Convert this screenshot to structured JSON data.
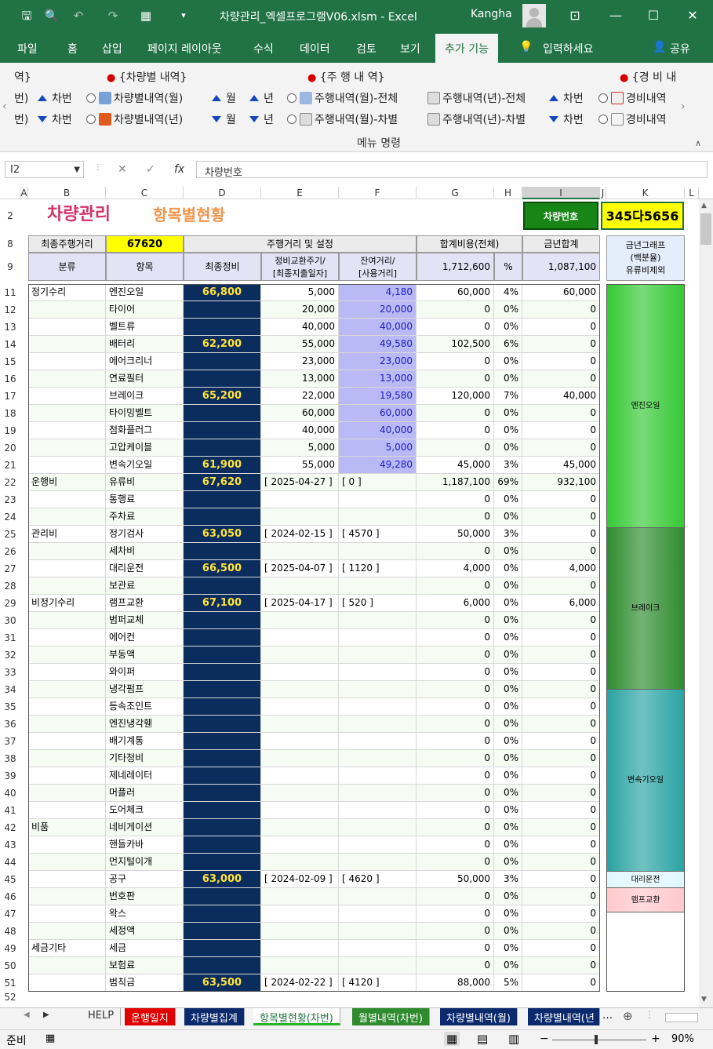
{
  "titlebar": {
    "title": "차량관리_엑셀프로그램V06.xlsm  -  Excel",
    "user": "Kangha"
  },
  "ribbon_tabs": [
    "파일",
    "홈",
    "삽입",
    "페이지 레이아웃",
    "수식",
    "데이터",
    "검토",
    "보기",
    "추가 기능"
  ],
  "tell_me": "입력하세요",
  "share": "공유",
  "ribbon": {
    "group1_head": "역}",
    "group2_head": "{차량별 내역}",
    "group3_head": "{주 행 내 역}",
    "group4_head": "{경 비 내",
    "row1": [
      "번)",
      "차번",
      "차량별내역(월)",
      "월",
      "년",
      "주행내역(월)-전체",
      "주행내역(년)-전체",
      "차번",
      "경비내역"
    ],
    "row2": [
      "번)",
      "차번",
      "차량별내역(년)",
      "월",
      "년",
      "주행내역(월)-차별",
      "주행내역(년)-차별",
      "차번",
      "경비내역"
    ],
    "menu_label": "메뉴 명령"
  },
  "formula_bar": {
    "namebox": "I2",
    "formula": "차량번호"
  },
  "columns": [
    "A",
    "B",
    "C",
    "D",
    "E",
    "F",
    "G",
    "H",
    "I",
    "J",
    "K",
    "L"
  ],
  "sheet": {
    "title": "차량관리",
    "subtitle": "항목별현황",
    "car_label": "차량번호",
    "car_no": "345다5656",
    "last_mileage_label": "최종주행거리",
    "last_mileage": "67620",
    "h_setting": "주행거리 및 설정",
    "h_total": "합계비용(전체)",
    "h_year": "금년합계",
    "h_graph": "금년그래프\n(백분율)\n유류비제외",
    "h_cat": "분류",
    "h_item": "항목",
    "h_last": "최종정비",
    "h_cycle": "정비교환주기/\n[최종지출일자]",
    "h_remain": "잔여거리/\n[사용거리]",
    "total_all": "1,712,600",
    "pct_label": "%",
    "total_year": "1,087,100"
  },
  "rows": [
    {
      "n": "11",
      "cat": "정기수리",
      "item": "엔진오일",
      "last": "66,800",
      "cycle": "5,000",
      "remain": "4,180",
      "total": "60,000",
      "pct": "4%",
      "year": "60,000"
    },
    {
      "n": "12",
      "cat": "",
      "item": "타이어",
      "last": "",
      "cycle": "20,000",
      "remain": "20,000",
      "total": "0",
      "pct": "0%",
      "year": "0"
    },
    {
      "n": "13",
      "cat": "",
      "item": "벨트류",
      "last": "",
      "cycle": "40,000",
      "remain": "40,000",
      "total": "0",
      "pct": "0%",
      "year": "0"
    },
    {
      "n": "14",
      "cat": "",
      "item": "배터리",
      "last": "62,200",
      "cycle": "55,000",
      "remain": "49,580",
      "total": "102,500",
      "pct": "6%",
      "year": "0"
    },
    {
      "n": "15",
      "cat": "",
      "item": "에어크리너",
      "last": "",
      "cycle": "23,000",
      "remain": "23,000",
      "total": "0",
      "pct": "0%",
      "year": "0"
    },
    {
      "n": "16",
      "cat": "",
      "item": "연료필터",
      "last": "",
      "cycle": "13,000",
      "remain": "13,000",
      "total": "0",
      "pct": "0%",
      "year": "0"
    },
    {
      "n": "17",
      "cat": "",
      "item": "브레이크",
      "last": "65,200",
      "cycle": "22,000",
      "remain": "19,580",
      "total": "120,000",
      "pct": "7%",
      "year": "40,000"
    },
    {
      "n": "18",
      "cat": "",
      "item": "타이밍벨트",
      "last": "",
      "cycle": "60,000",
      "remain": "60,000",
      "total": "0",
      "pct": "0%",
      "year": "0"
    },
    {
      "n": "19",
      "cat": "",
      "item": "점화플러그",
      "last": "",
      "cycle": "40,000",
      "remain": "40,000",
      "total": "0",
      "pct": "0%",
      "year": "0"
    },
    {
      "n": "20",
      "cat": "",
      "item": "고압케이블",
      "last": "",
      "cycle": "5,000",
      "remain": "5,000",
      "total": "0",
      "pct": "0%",
      "year": "0"
    },
    {
      "n": "21",
      "cat": "",
      "item": "변속기오일",
      "last": "61,900",
      "cycle": "55,000",
      "remain": "49,280",
      "total": "45,000",
      "pct": "3%",
      "year": "45,000"
    },
    {
      "n": "22",
      "cat": "운행비",
      "item": "유류비",
      "last": "67,620",
      "cycle": "[ 2025-04-27 ]",
      "remain": "[ 0 ]",
      "total": "1,187,100",
      "pct": "69%",
      "year": "932,100"
    },
    {
      "n": "23",
      "cat": "",
      "item": "통행료",
      "last": "",
      "cycle": "",
      "remain": "",
      "total": "0",
      "pct": "0%",
      "year": "0"
    },
    {
      "n": "24",
      "cat": "",
      "item": "주차료",
      "last": "",
      "cycle": "",
      "remain": "",
      "total": "0",
      "pct": "0%",
      "year": "0"
    },
    {
      "n": "25",
      "cat": "관리비",
      "item": "정기검사",
      "last": "63,050",
      "cycle": "[ 2024-02-15 ]",
      "remain": "[ 4570 ]",
      "total": "50,000",
      "pct": "3%",
      "year": "0"
    },
    {
      "n": "26",
      "cat": "",
      "item": "세차비",
      "last": "",
      "cycle": "",
      "remain": "",
      "total": "0",
      "pct": "0%",
      "year": "0"
    },
    {
      "n": "27",
      "cat": "",
      "item": "대리운전",
      "last": "66,500",
      "cycle": "[ 2025-04-07 ]",
      "remain": "[ 1120 ]",
      "total": "4,000",
      "pct": "0%",
      "year": "4,000"
    },
    {
      "n": "28",
      "cat": "",
      "item": "보관료",
      "last": "",
      "cycle": "",
      "remain": "",
      "total": "0",
      "pct": "0%",
      "year": "0"
    },
    {
      "n": "29",
      "cat": "비정기수리",
      "item": "램프교환",
      "last": "67,100",
      "cycle": "[ 2025-04-17 ]",
      "remain": "[ 520 ]",
      "total": "6,000",
      "pct": "0%",
      "year": "6,000"
    },
    {
      "n": "30",
      "cat": "",
      "item": "범퍼교체",
      "last": "",
      "cycle": "",
      "remain": "",
      "total": "0",
      "pct": "0%",
      "year": "0"
    },
    {
      "n": "31",
      "cat": "",
      "item": "에어컨",
      "last": "",
      "cycle": "",
      "remain": "",
      "total": "0",
      "pct": "0%",
      "year": "0"
    },
    {
      "n": "32",
      "cat": "",
      "item": "부동액",
      "last": "",
      "cycle": "",
      "remain": "",
      "total": "0",
      "pct": "0%",
      "year": "0"
    },
    {
      "n": "33",
      "cat": "",
      "item": "와이퍼",
      "last": "",
      "cycle": "",
      "remain": "",
      "total": "0",
      "pct": "0%",
      "year": "0"
    },
    {
      "n": "34",
      "cat": "",
      "item": "냉각펌프",
      "last": "",
      "cycle": "",
      "remain": "",
      "total": "0",
      "pct": "0%",
      "year": "0"
    },
    {
      "n": "35",
      "cat": "",
      "item": "등속조인트",
      "last": "",
      "cycle": "",
      "remain": "",
      "total": "0",
      "pct": "0%",
      "year": "0"
    },
    {
      "n": "36",
      "cat": "",
      "item": "엔진냉각휀",
      "last": "",
      "cycle": "",
      "remain": "",
      "total": "0",
      "pct": "0%",
      "year": "0"
    },
    {
      "n": "37",
      "cat": "",
      "item": "배기계통",
      "last": "",
      "cycle": "",
      "remain": "",
      "total": "0",
      "pct": "0%",
      "year": "0"
    },
    {
      "n": "38",
      "cat": "",
      "item": "기타정비",
      "last": "",
      "cycle": "",
      "remain": "",
      "total": "0",
      "pct": "0%",
      "year": "0"
    },
    {
      "n": "39",
      "cat": "",
      "item": "제네레이터",
      "last": "",
      "cycle": "",
      "remain": "",
      "total": "0",
      "pct": "0%",
      "year": "0"
    },
    {
      "n": "40",
      "cat": "",
      "item": "머플러",
      "last": "",
      "cycle": "",
      "remain": "",
      "total": "0",
      "pct": "0%",
      "year": "0"
    },
    {
      "n": "41",
      "cat": "",
      "item": "도어체크",
      "last": "",
      "cycle": "",
      "remain": "",
      "total": "0",
      "pct": "0%",
      "year": "0"
    },
    {
      "n": "42",
      "cat": "비품",
      "item": "네비게이션",
      "last": "",
      "cycle": "",
      "remain": "",
      "total": "0",
      "pct": "0%",
      "year": "0"
    },
    {
      "n": "43",
      "cat": "",
      "item": "핸들카바",
      "last": "",
      "cycle": "",
      "remain": "",
      "total": "0",
      "pct": "0%",
      "year": "0"
    },
    {
      "n": "44",
      "cat": "",
      "item": "먼지털이개",
      "last": "",
      "cycle": "",
      "remain": "",
      "total": "0",
      "pct": "0%",
      "year": "0"
    },
    {
      "n": "45",
      "cat": "",
      "item": "공구",
      "last": "63,000",
      "cycle": "[ 2024-02-09 ]",
      "remain": "[ 4620 ]",
      "total": "50,000",
      "pct": "3%",
      "year": "0"
    },
    {
      "n": "46",
      "cat": "",
      "item": "번호판",
      "last": "",
      "cycle": "",
      "remain": "",
      "total": "0",
      "pct": "0%",
      "year": "0"
    },
    {
      "n": "47",
      "cat": "",
      "item": "왁스",
      "last": "",
      "cycle": "",
      "remain": "",
      "total": "0",
      "pct": "0%",
      "year": "0"
    },
    {
      "n": "48",
      "cat": "",
      "item": "세정액",
      "last": "",
      "cycle": "",
      "remain": "",
      "total": "0",
      "pct": "0%",
      "year": "0"
    },
    {
      "n": "49",
      "cat": "세금기타",
      "item": "세금",
      "last": "",
      "cycle": "",
      "remain": "",
      "total": "0",
      "pct": "0%",
      "year": "0"
    },
    {
      "n": "50",
      "cat": "",
      "item": "보험료",
      "last": "",
      "cycle": "",
      "remain": "",
      "total": "0",
      "pct": "0%",
      "year": "0"
    },
    {
      "n": "51",
      "cat": "",
      "item": "범칙금",
      "last": "63,500",
      "cycle": "[ 2024-02-22 ]",
      "remain": "[ 4120 ]",
      "total": "88,000",
      "pct": "5%",
      "year": "0"
    }
  ],
  "graph": [
    {
      "label": "엔진오일",
      "share": 0.344,
      "color": "#35c935"
    },
    {
      "label": "브레이크",
      "share": 0.229,
      "color": "#2e8b2e"
    },
    {
      "label": "변속기오일",
      "share": 0.258,
      "color": "#2aa3a3"
    },
    {
      "label": "대리운전",
      "share": 0.023,
      "color": "#e0f7ff"
    },
    {
      "label": "램프교환",
      "share": 0.034,
      "color": "#ffc8cc"
    }
  ],
  "sheet_tabs": [
    "HELP",
    "운행일지",
    "차량별집계",
    "항목별현황(차번)",
    "월별내역(차번)",
    "차량별내역(월)",
    "차량별내역(년"
  ],
  "status": {
    "ready": "준비",
    "zoom": "90%"
  }
}
